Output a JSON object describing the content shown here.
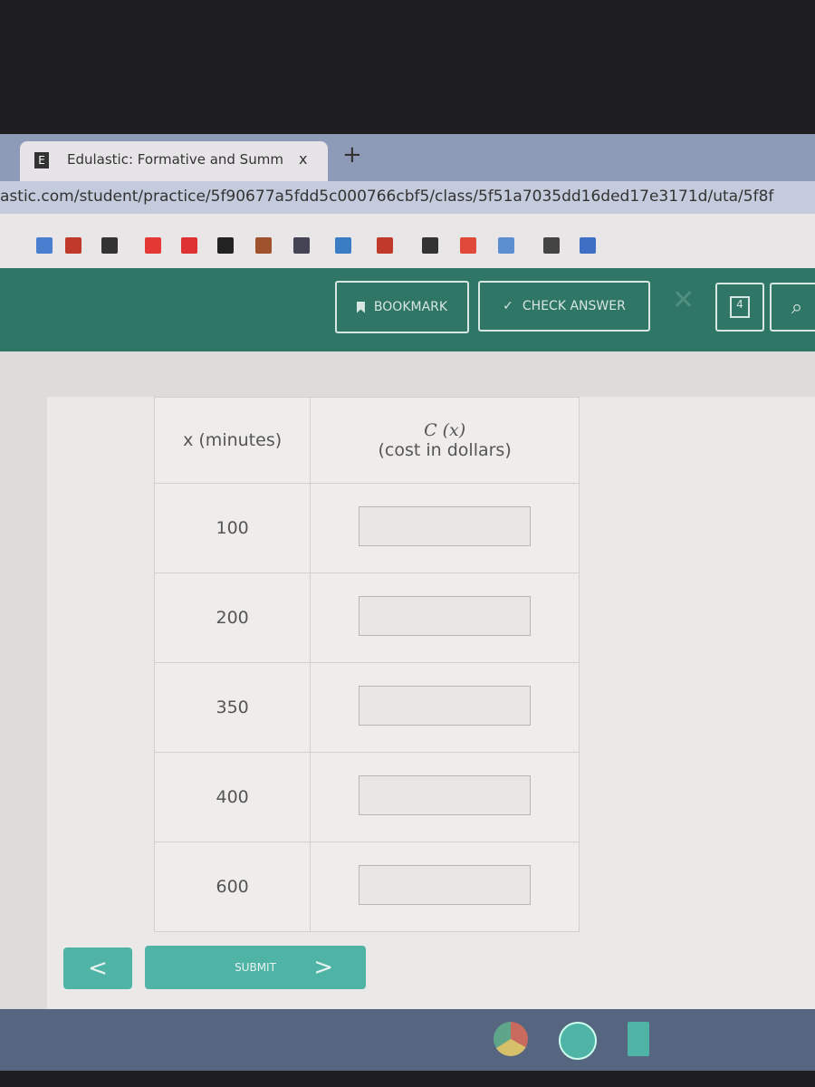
{
  "browser": {
    "tab_title": "Edulastic: Formative and Summ",
    "tab_close": "x",
    "new_tab": "+",
    "url": "astic.com/student/practice/5f90677a5fdd5c000766cbf5/class/5f51a7035dd16ded17e3171d/uta/5f8f",
    "bookmark_icons": [
      "drive-icon",
      "pinterest-icon",
      "square-icon",
      "youtube-icon",
      "mi-icon",
      "r-icon",
      "classroom-icon",
      "desmos-icon",
      "compass-icon",
      "netflix-icon",
      "circle-icon",
      "e-icon",
      "pattern-icon",
      "edge-icon",
      "s-icon"
    ]
  },
  "toolbar": {
    "bookmark_label": "BOOKMARK",
    "check_answer_label": "CHECK ANSWER",
    "accent": "#2f7666"
  },
  "table": {
    "headers": {
      "x": "x (minutes)",
      "c_func": "C (x)",
      "c_desc": "(cost in dollars)"
    },
    "rows": [
      {
        "x": "100",
        "value": ""
      },
      {
        "x": "200",
        "value": ""
      },
      {
        "x": "350",
        "value": ""
      },
      {
        "x": "400",
        "value": ""
      },
      {
        "x": "600",
        "value": ""
      }
    ]
  },
  "nav": {
    "prev": "<",
    "submit": "SUBMIT",
    "next": ">",
    "button_color": "#4fb3a6"
  },
  "taskbar": {
    "apps": [
      "chrome-icon",
      "zoom-icon",
      "docs-icon"
    ]
  }
}
